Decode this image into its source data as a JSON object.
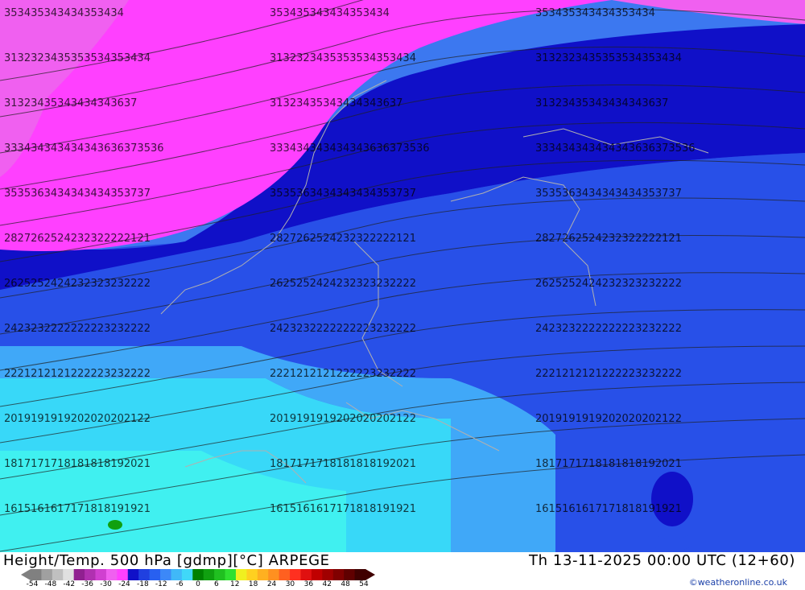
{
  "map": {
    "background_bands": [
      {
        "name": "very-cold",
        "color": "#f060f0"
      },
      {
        "name": "cold",
        "color": "#ff40ff"
      },
      {
        "name": "deep-blue",
        "color": "#1010c8"
      },
      {
        "name": "blue",
        "color": "#2850e8"
      },
      {
        "name": "mid-blue",
        "color": "#3c78f0"
      },
      {
        "name": "light-blue",
        "color": "#40a8f8"
      },
      {
        "name": "cyan",
        "color": "#38d8f8"
      },
      {
        "name": "aqua",
        "color": "#40f0f0"
      }
    ],
    "contour_label_rows": [
      {
        "label": "353435343434353434",
        "color": "#000"
      },
      {
        "label": "3132323435353534353434",
        "color": "#000"
      },
      {
        "label": "31323435343434343637",
        "color": "#000"
      },
      {
        "label": "333434343434343636373536",
        "color": "#000"
      },
      {
        "label": "3535363434343434353737",
        "color": "#000"
      },
      {
        "label": "2827262524232322222121",
        "color": "#000"
      },
      {
        "label": "2625252424232323232222",
        "color": "#000"
      },
      {
        "label": "2423232222222223232222",
        "color": "#000"
      },
      {
        "label": "2221212121222223232222",
        "color": "#000"
      },
      {
        "label": "2019191919202020202122",
        "color": "#000"
      },
      {
        "label": "1817171718181818192021",
        "color": "#000"
      },
      {
        "label": "1615161617171818191921",
        "color": "#000"
      }
    ]
  },
  "footer": {
    "title_left": "Height/Temp. 500 hPa [gdmp][°C] ARPEGE",
    "title_right": "Th 13-11-2025 00:00 UTC (12+60)",
    "credit": "©weatheronline.co.uk",
    "legend": {
      "ticks": [
        "-54",
        "-48",
        "-42",
        "-36",
        "-30",
        "-24",
        "-18",
        "-12",
        "-6",
        "0",
        "6",
        "12",
        "18",
        "24",
        "30",
        "36",
        "42",
        "48",
        "54"
      ],
      "colors": [
        "#808080",
        "#a0a0a0",
        "#c0c0c0",
        "#e0e0e0",
        "#902090",
        "#b030b0",
        "#d040d0",
        "#f060f0",
        "#ff40ff",
        "#1010c8",
        "#2040e0",
        "#2860f0",
        "#3c88f8",
        "#40b8f8",
        "#40d8f8",
        "#008000",
        "#10a010",
        "#20c020",
        "#30e030",
        "#f0f020",
        "#ffd020",
        "#ffb020",
        "#ff9020",
        "#ff6020",
        "#ff3020",
        "#e01010",
        "#c00000",
        "#a00000",
        "#800000",
        "#600000",
        "#400000"
      ]
    }
  }
}
